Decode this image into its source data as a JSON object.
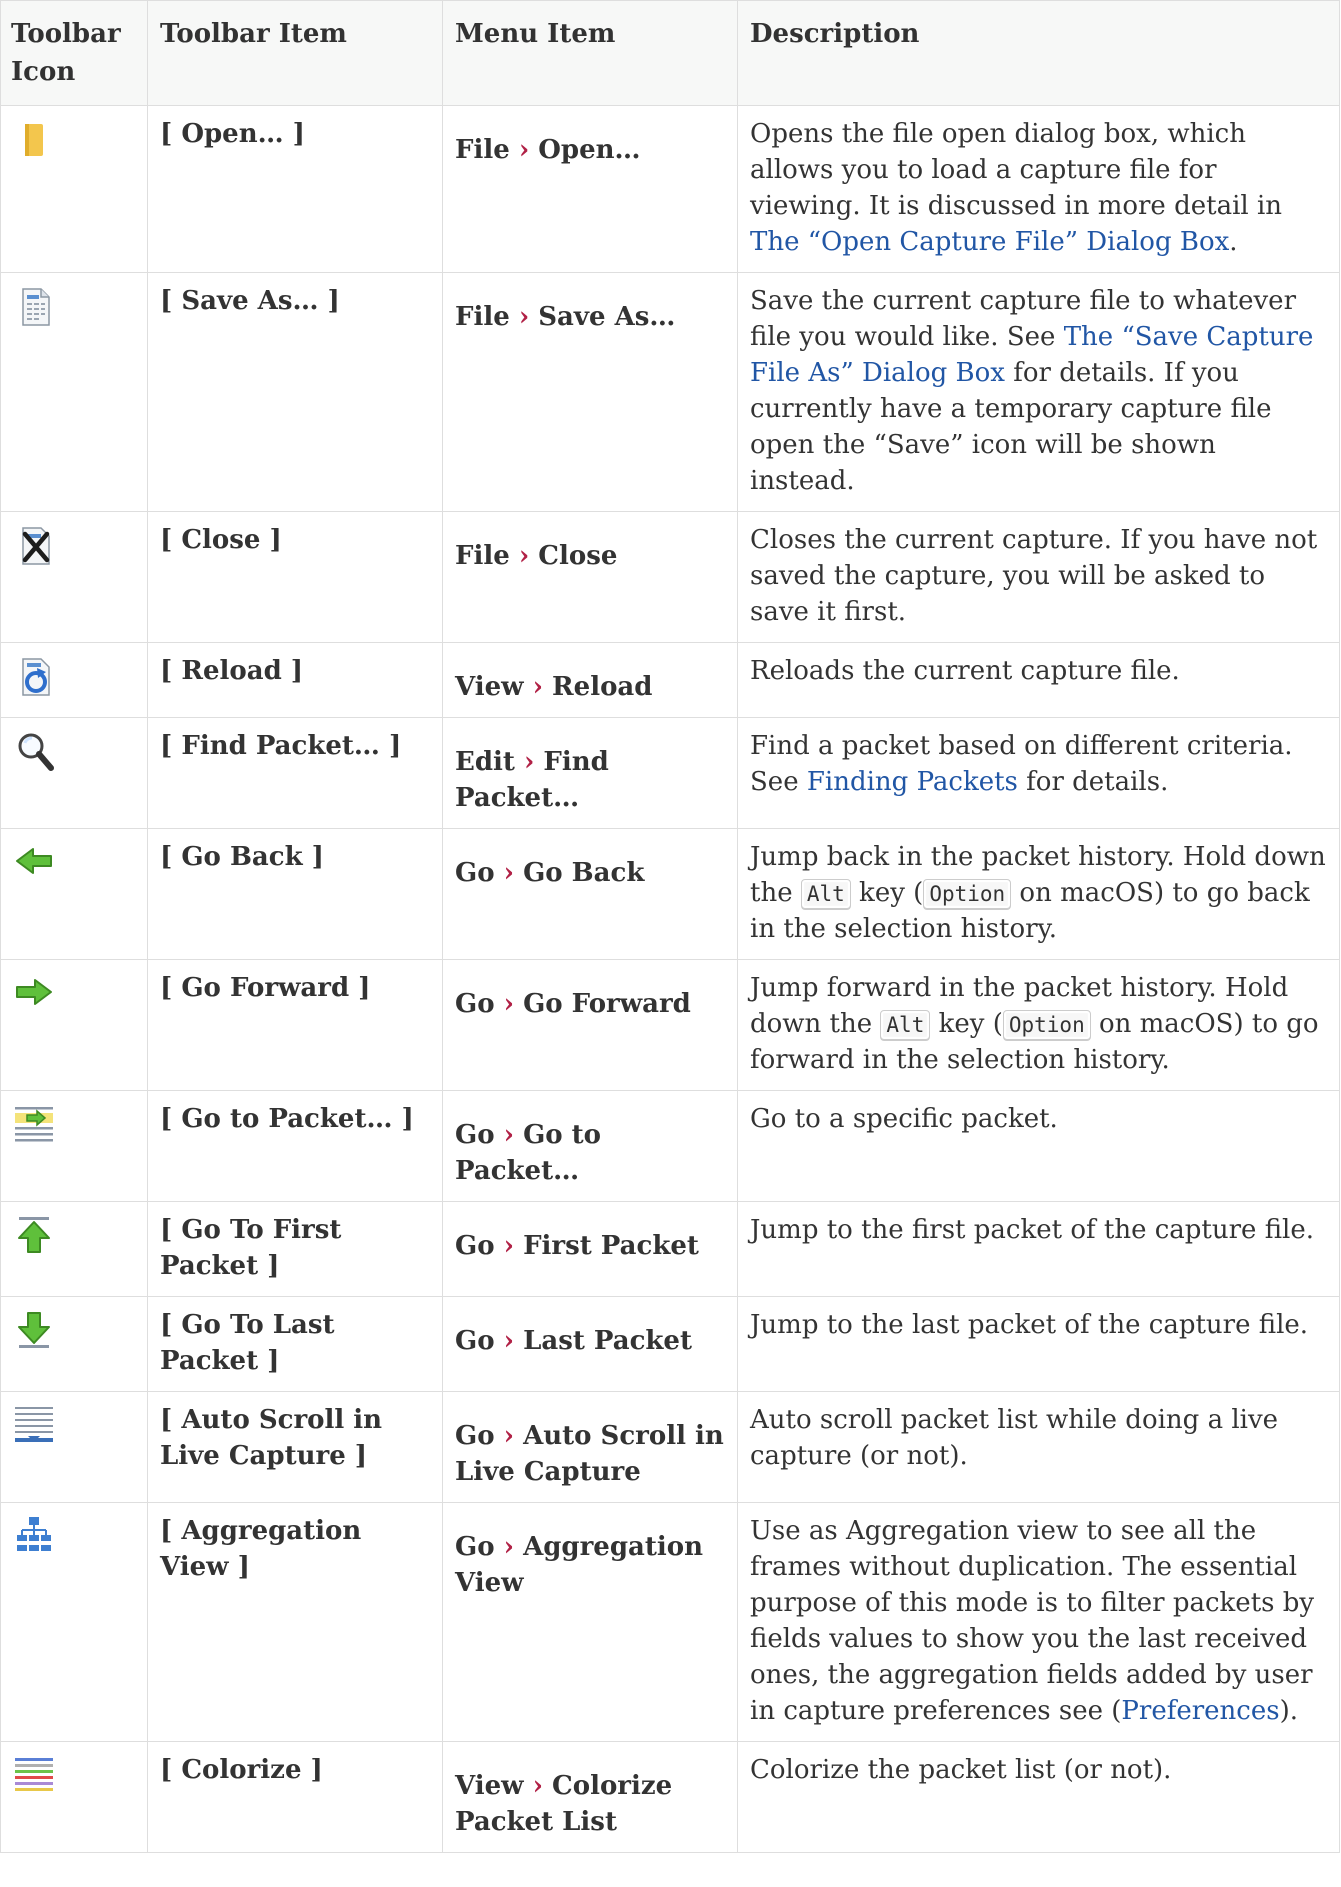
{
  "headers": [
    "Toolbar Icon",
    "Toolbar Item",
    "Menu Item",
    "Description"
  ],
  "rows": [
    {
      "icon": "folder-open-icon",
      "item": "[ Open… ]",
      "menu": [
        "File",
        "Open…"
      ],
      "desc": [
        {
          "t": "Opens the file open dialog box, which allows you to load a capture file for viewing. It is discussed in more detail in "
        },
        {
          "link": "The “Open Capture File” Dialog Box"
        },
        {
          "t": "."
        }
      ]
    },
    {
      "icon": "save-as-file-icon",
      "item": "[ Save As… ]",
      "menu": [
        "File",
        "Save As…"
      ],
      "desc": [
        {
          "t": "Save the current capture file to whatever file you would like. See "
        },
        {
          "link": "The “Save Capture File As” Dialog Box"
        },
        {
          "t": " for details. If you currently have a temporary capture file open the “Save” icon will be shown instead."
        }
      ]
    },
    {
      "icon": "close-file-icon",
      "item": "[ Close ]",
      "menu": [
        "File",
        "Close"
      ],
      "desc": [
        {
          "t": "Closes the current capture. If you have not saved the capture, you will be asked to save it first."
        }
      ]
    },
    {
      "icon": "reload-icon",
      "item": "[ Reload ]",
      "menu": [
        "View",
        "Reload"
      ],
      "desc": [
        {
          "t": "Reloads the current capture file."
        }
      ]
    },
    {
      "icon": "magnifier-icon",
      "item": "[ Find Packet… ]",
      "menu": [
        "Edit",
        "Find Packet…"
      ],
      "desc": [
        {
          "t": "Find a packet based on different criteria. See "
        },
        {
          "link": "Finding Packets"
        },
        {
          "t": " for details."
        }
      ]
    },
    {
      "icon": "arrow-left-icon",
      "item": "[ Go Back ]",
      "menu": [
        "Go",
        "Go Back"
      ],
      "desc": [
        {
          "t": "Jump back in the packet history. Hold down the "
        },
        {
          "kbd": "Alt"
        },
        {
          "t": " key ("
        },
        {
          "kbd": "Option"
        },
        {
          "t": " on macOS) to go back in the selection history."
        }
      ]
    },
    {
      "icon": "arrow-right-icon",
      "item": "[ Go Forward ]",
      "menu": [
        "Go",
        "Go Forward"
      ],
      "desc": [
        {
          "t": "Jump forward in the packet history. Hold down the "
        },
        {
          "kbd": "Alt"
        },
        {
          "t": " key ("
        },
        {
          "kbd": "Option"
        },
        {
          "t": " on macOS) to go forward in the selection history."
        }
      ]
    },
    {
      "icon": "go-to-packet-icon",
      "item": "[ Go to Packet… ]",
      "menu": [
        "Go",
        "Go to Packet…"
      ],
      "desc": [
        {
          "t": "Go to a specific packet."
        }
      ]
    },
    {
      "icon": "go-first-icon",
      "item": "[ Go To First Packet ]",
      "menu": [
        "Go",
        "First Packet"
      ],
      "desc": [
        {
          "t": "Jump to the first packet of the capture file."
        }
      ]
    },
    {
      "icon": "go-last-icon",
      "item": "[ Go To Last Packet ]",
      "menu": [
        "Go",
        "Last Packet"
      ],
      "desc": [
        {
          "t": "Jump to the last packet of the capture file."
        }
      ]
    },
    {
      "icon": "auto-scroll-icon",
      "item": "[ Auto Scroll in Live Capture ]",
      "menu": [
        "Go",
        "Auto Scroll in Live Capture"
      ],
      "desc": [
        {
          "t": "Auto scroll packet list while doing a live capture (or not)."
        }
      ]
    },
    {
      "icon": "aggregation-tree-icon",
      "item": "[ Aggregation View ]",
      "menu": [
        "Go",
        "Aggregation View"
      ],
      "desc": [
        {
          "t": "Use as Aggregation view to see all the frames without duplication. The essential purpose of this mode is to filter packets by fields values to show you the last received ones, the aggregation fields added by user in capture preferences see ("
        },
        {
          "link": "Preferences"
        },
        {
          "t": ")."
        }
      ]
    },
    {
      "icon": "colorize-icon",
      "item": "[ Colorize ]",
      "menu": [
        "View",
        "Colorize Packet List"
      ],
      "desc": [
        {
          "t": "Colorize the packet list (or not)."
        }
      ]
    }
  ]
}
